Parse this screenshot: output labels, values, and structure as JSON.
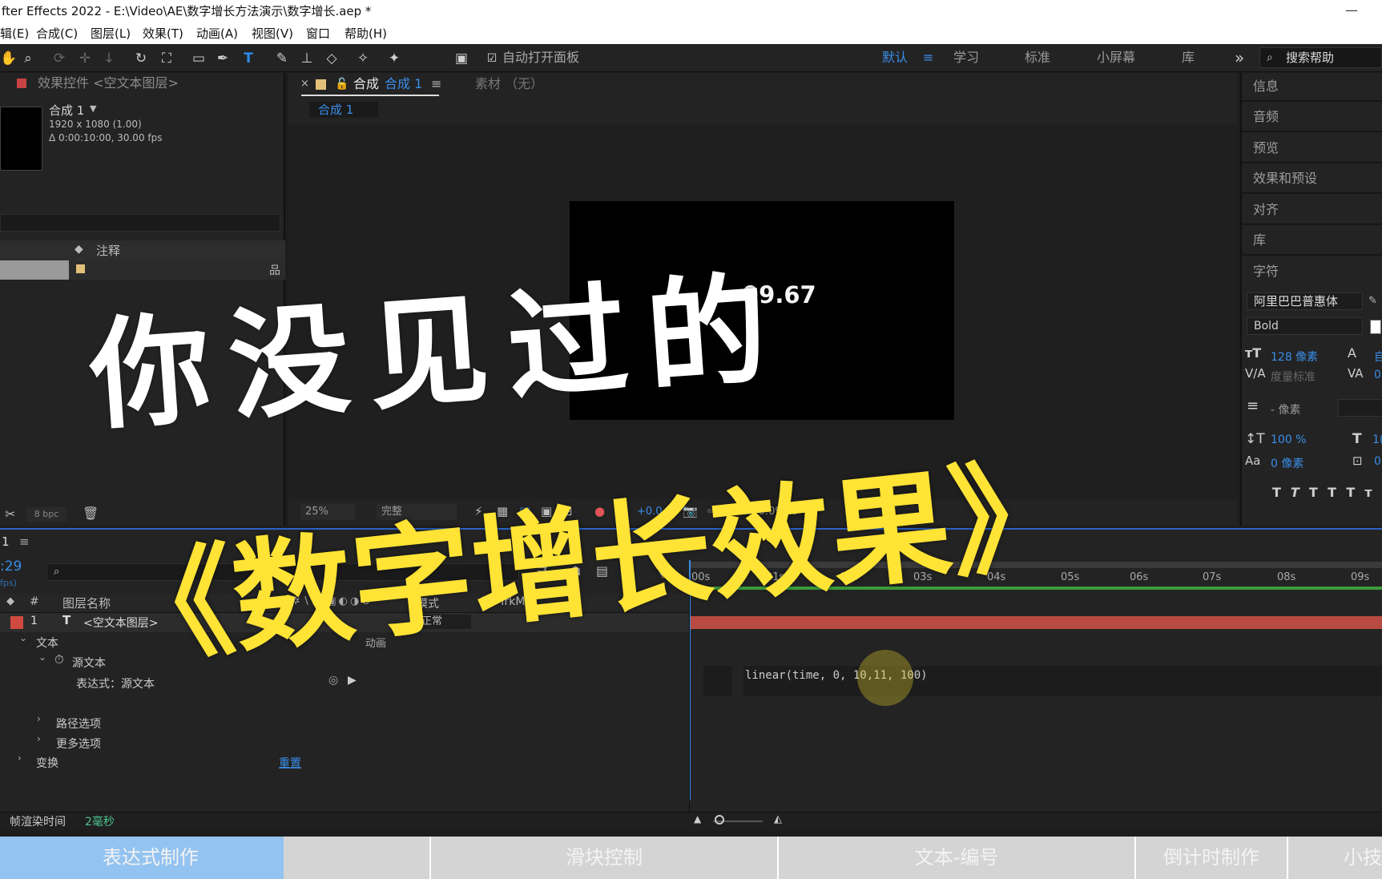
{
  "window": {
    "title": "fter Effects 2022 - E:\\Video\\AE\\数字增长方法演示\\数字增长.aep *",
    "minimize": "—"
  },
  "menu": [
    "辑(E)",
    "合成(C)",
    "图层(L)",
    "效果(T)",
    "动画(A)",
    "视图(V)",
    "窗口",
    "帮助(H)"
  ],
  "toolbar": {
    "auto_open_panel": "自动打开面板",
    "workspaces": [
      "默认",
      "学习",
      "标准",
      "小屏幕",
      "库"
    ],
    "more": "»",
    "search_label": "搜索帮助"
  },
  "effects_panel": {
    "title": "效果控件 <空文本图层>",
    "comp_name": "合成  1",
    "comp_size": "1920 x 1080 (1.00)",
    "comp_duration": "Δ 0:00:10:00, 30.00 fps",
    "column_comment": "注释",
    "bpc": "8 bpc"
  },
  "comp_panel": {
    "tab_label": "合成",
    "tab_name": "合成 1",
    "footage_label": "素材 （无）",
    "breadcrumb": "合成 1",
    "viewer_text": "99.67",
    "zoom": "25%",
    "quality": "完整",
    "exposure": "+0.0",
    "timecode": "0:00:09:29"
  },
  "right_panel": {
    "items": [
      "信息",
      "音频",
      "预览",
      "效果和预设",
      "对齐",
      "库",
      "字符"
    ],
    "font_family": "阿里巴巴普惠体",
    "font_style": "Bold",
    "font_size": "128 像素",
    "kerning": "度量标准",
    "leading": "- 像素",
    "vscale": "100 %",
    "baseline": "0 像素",
    "right_val_1": "自",
    "right_val_2": "0",
    "right_val_3": "1(",
    "right_val_4": "0"
  },
  "timeline": {
    "tab": "1",
    "timecode": ":29",
    "fps": "fps)",
    "col_num": "#",
    "col_layer_name": "图层名称",
    "col_mode": "模式",
    "col_t": "T",
    "col_trkmat": "TrkMat",
    "layer_num": "1",
    "layer_name": "<空文本图层>",
    "mode_value": "正常",
    "prop_text": "文本",
    "prop_anim": "动画",
    "prop_source_text": "源文本",
    "prop_expression": "表达式：源文本",
    "prop_path": "路径选项",
    "prop_more": "更多选项",
    "prop_transform": "变换",
    "reset": "重置",
    "expression_code": "linear(time, 0, 10,11, 100)",
    "ruler": [
      "00s",
      "01s",
      "02s",
      "03s",
      "04s",
      "05s",
      "06s",
      "07s",
      "08s",
      "09s"
    ],
    "render_time_label": "帧渲染时间",
    "render_time_value": "2毫秒"
  },
  "overlay": {
    "line1": "你没见过的",
    "line2": "《数字增长效果》"
  },
  "chapter_tabs": [
    "表达式制作",
    "滑块控制",
    "文本-编号",
    "倒计时制作",
    "小技"
  ]
}
